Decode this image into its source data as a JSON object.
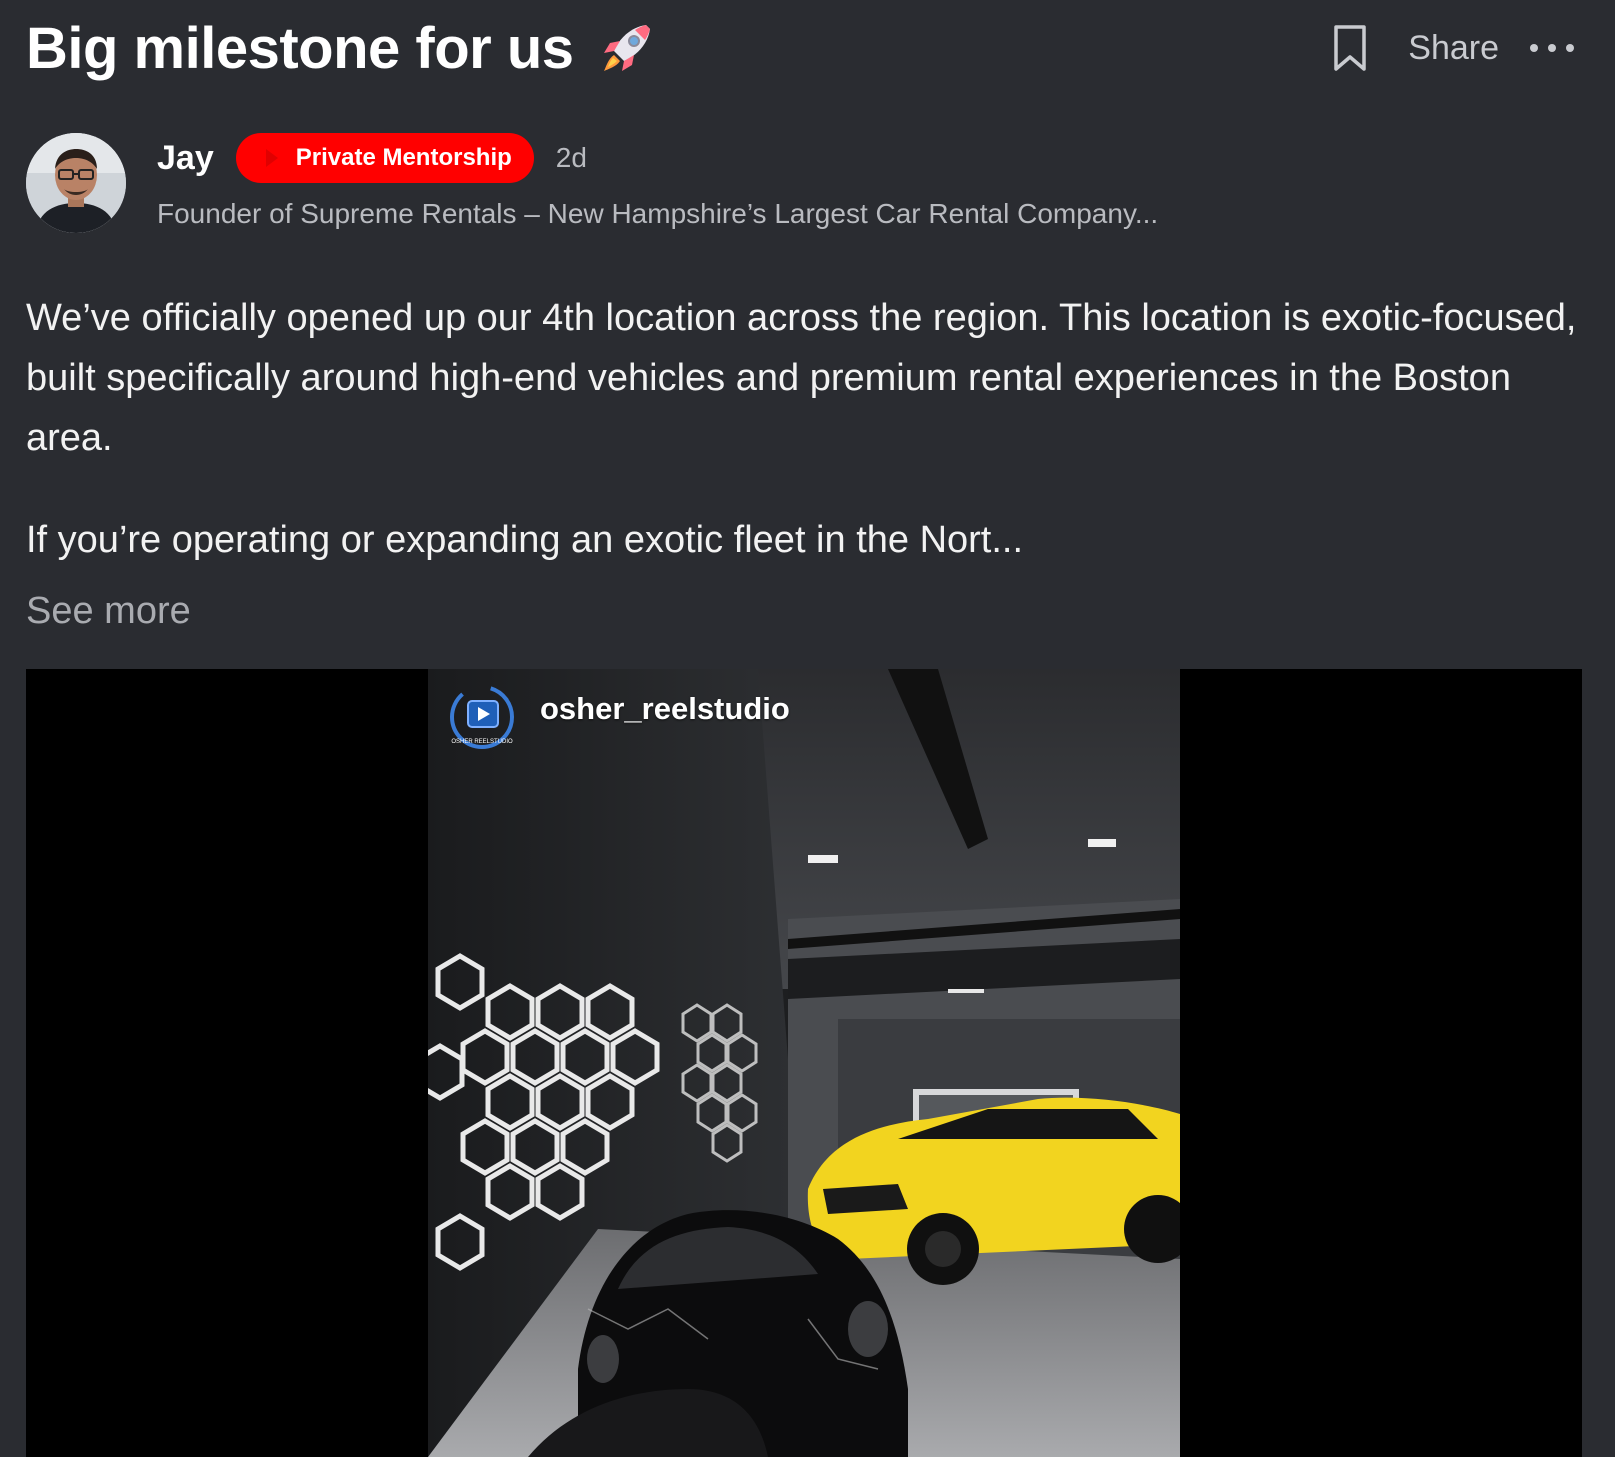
{
  "post": {
    "title": "Big milestone for us",
    "title_emoji": "rocket-icon",
    "share_label": "Share"
  },
  "author": {
    "name": "Jay",
    "badge": "Private Mentorship",
    "time": "2d",
    "subtitle": "Founder of Supreme Rentals – New Hampshire’s Largest Car Rental Company..."
  },
  "body": {
    "paragraph1": "We’ve officially opened up our 4th location across the region. This location is exotic-focused, built specifically around high-end vehicles and premium rental experiences in the Boston area.",
    "paragraph2": "If you’re operating or expanding an exotic fleet in the Nort...",
    "see_more": "See more"
  },
  "media": {
    "watermark": "osher_reelstudio",
    "watermark_logo": "reel-studio-logo",
    "watermark_logo_text": "OSHER REELSTUDIO"
  },
  "colors": {
    "background": "#2a2c31",
    "badge": "#ff0000",
    "muted_text": "#b9bbc0"
  }
}
